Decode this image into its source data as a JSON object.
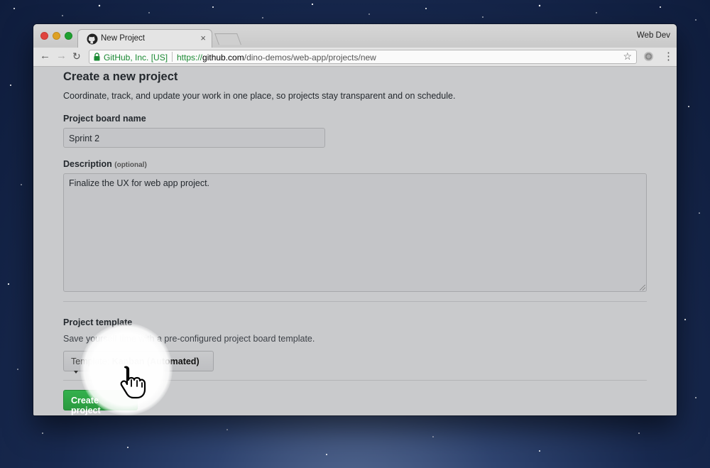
{
  "browser": {
    "tab_title": "New Project",
    "tab_close": "×",
    "profile_name": "Web Dev",
    "secure_label": "GitHub, Inc. [US]",
    "url_scheme": "https://",
    "url_host": "github.com",
    "url_path": "/dino-demos/web-app/projects/new"
  },
  "page": {
    "title": "Create a new project",
    "lead": "Coordinate, track, and update your work in one place, so projects stay transparent and on schedule.",
    "name_label": "Project board name",
    "name_value": "Sprint 2",
    "description_label": "Description",
    "description_optional": "(optional)",
    "description_value": "Finalize the UX for web app project.",
    "template_heading": "Project template",
    "template_note": "Save yourself time with a pre-configured project board template.",
    "template_prefix": "Template:",
    "template_value": "Kanban (Automated)",
    "create_button": "Create project"
  },
  "colors": {
    "accent_green": "#2ea44f",
    "secure_green": "#1b8a34"
  },
  "icons": [
    "github-icon",
    "back-icon",
    "forward-icon",
    "reload-icon",
    "lock-icon",
    "star-icon",
    "extension-icon",
    "menu-icon",
    "hand-cursor-icon"
  ]
}
